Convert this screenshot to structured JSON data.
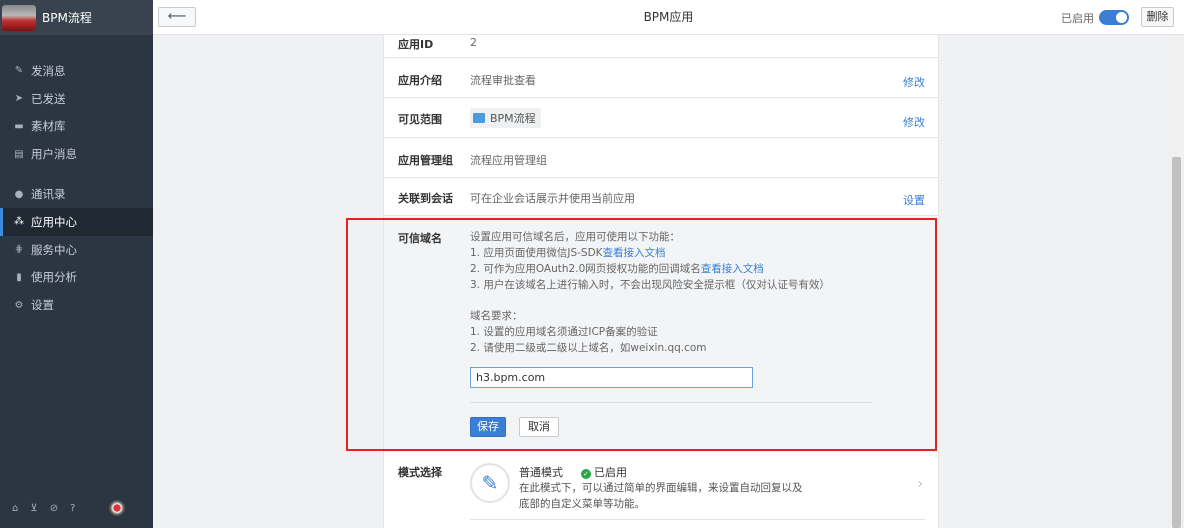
{
  "sidebar": {
    "title": "BPM流程",
    "items": [
      {
        "label": "发消息",
        "icon": "pencil-icon",
        "glyph": "✎"
      },
      {
        "label": "已发送",
        "icon": "send-icon",
        "glyph": "➤"
      },
      {
        "label": "素材库",
        "icon": "archive-icon",
        "glyph": "▬"
      },
      {
        "label": "用户消息",
        "icon": "message-icon",
        "glyph": "▤"
      },
      {
        "label": "通讯录",
        "icon": "user-icon",
        "glyph": "●"
      },
      {
        "label": "应用中心",
        "icon": "apps-icon",
        "glyph": "⁂"
      },
      {
        "label": "服务中心",
        "icon": "grid-icon",
        "glyph": "⋕"
      },
      {
        "label": "使用分析",
        "icon": "bar-chart-icon",
        "glyph": "▮"
      },
      {
        "label": "设置",
        "icon": "gear-icon",
        "glyph": "⚙"
      }
    ],
    "footer": {
      "home": "⌂",
      "cart": "⊻",
      "ban": "⊘",
      "help": "?"
    }
  },
  "topbar": {
    "back": "⟵",
    "title": "BPM应用",
    "enabled_label": "已启用",
    "toggle_on": true,
    "delete_label": "删除"
  },
  "rows": {
    "app_id": {
      "label": "应用ID",
      "value": "2"
    },
    "intro": {
      "label": "应用介绍",
      "value": "流程审批查看",
      "action": "修改"
    },
    "scope": {
      "label": "可见范围",
      "value": "BPM流程",
      "action": "修改"
    },
    "group": {
      "label": "应用管理组",
      "value": "流程应用管理组"
    },
    "session": {
      "label": "关联到会话",
      "value": "可在企业会话展示并使用当前应用",
      "action": "设置"
    }
  },
  "domain": {
    "label": "可信域名",
    "line1": "设置应用可信域名后，应用可使用以下功能：",
    "line2_pre": "1. 应用页面使用微信JS-SDK",
    "line2_link": "查看接入文档",
    "line3_pre": "2. 可作为应用OAuth2.0网页授权功能的回调域名",
    "line3_link": "查看接入文档",
    "line4": "3. 用户在该域名上进行输入时，不会出现风险安全提示框（仅对认证号有效）",
    "req_title": "域名要求：",
    "req1": "1. 设置的应用域名须通过ICP备案的验证",
    "req2": "2. 请使用二级或二级以上域名，如weixin.qq.com",
    "input_value": "h3.bpm.com",
    "save": "保存",
    "cancel": "取消"
  },
  "mode": {
    "label": "模式选择",
    "title": "普通模式",
    "status": "已启用",
    "desc1": "在此模式下，可以通过简单的界面编辑，来设置自动回复以及",
    "desc2": "底部的自定义菜单等功能。"
  }
}
